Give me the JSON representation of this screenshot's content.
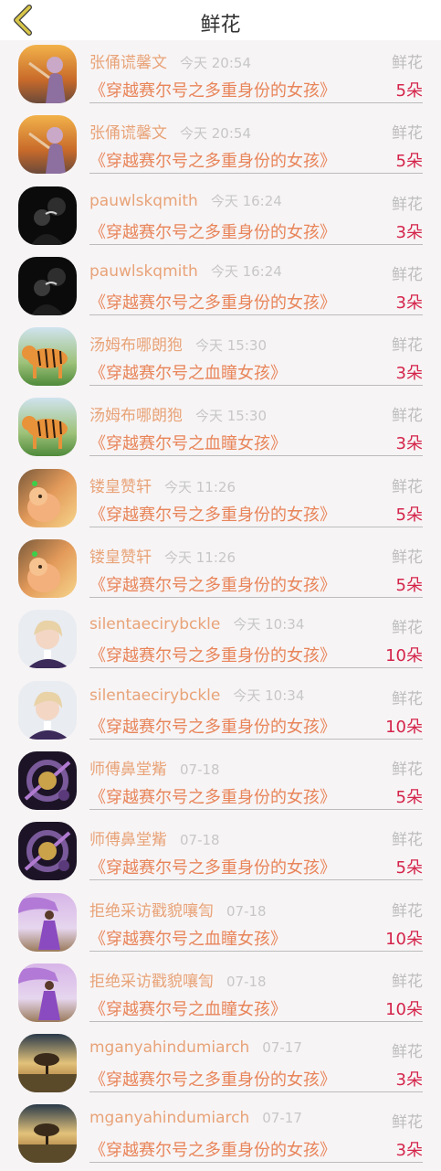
{
  "header": {
    "title": "鲜花",
    "back_icon": "chevron-left-icon",
    "back_color": "#d8c64a"
  },
  "rows": [
    {
      "name": "张俑谎馨文",
      "time": "今天 20:54",
      "type": "鲜花",
      "book": "《穿越赛尔号之多重身份的女孩》",
      "count": "5朵",
      "avatar": "girl-autumn"
    },
    {
      "name": "张俑谎馨文",
      "time": "今天 20:54",
      "type": "鲜花",
      "book": "《穿越赛尔号之多重身份的女孩》",
      "count": "5朵",
      "avatar": "girl-autumn"
    },
    {
      "name": "pauwlskqmith",
      "time": "今天 16:24",
      "type": "鲜花",
      "book": "《穿越赛尔号之多重身份的女孩》",
      "count": "3朵",
      "avatar": "dark-couple"
    },
    {
      "name": "pauwlskqmith",
      "time": "今天 16:24",
      "type": "鲜花",
      "book": "《穿越赛尔号之多重身份的女孩》",
      "count": "3朵",
      "avatar": "dark-couple"
    },
    {
      "name": "汤姆布哪朗狍",
      "time": "今天 15:30",
      "type": "鲜花",
      "book": "《穿越赛尔号之血瞳女孩》",
      "count": "3朵",
      "avatar": "tiger"
    },
    {
      "name": "汤姆布哪朗狍",
      "time": "今天 15:30",
      "type": "鲜花",
      "book": "《穿越赛尔号之血瞳女孩》",
      "count": "3朵",
      "avatar": "tiger"
    },
    {
      "name": "镂皇赞轩",
      "time": "今天 11:26",
      "type": "鲜花",
      "book": "《穿越赛尔号之多重身份的女孩》",
      "count": "5朵",
      "avatar": "pig"
    },
    {
      "name": "镂皇赞轩",
      "time": "今天 11:26",
      "type": "鲜花",
      "book": "《穿越赛尔号之多重身份的女孩》",
      "count": "5朵",
      "avatar": "pig"
    },
    {
      "name": "silentaecirybckle",
      "time": "今天 10:34",
      "type": "鲜花",
      "book": "《穿越赛尔号之多重身份的女孩》",
      "count": "10朵",
      "avatar": "blond-boy"
    },
    {
      "name": "silentaecirybckle",
      "time": "今天 10:34",
      "type": "鲜花",
      "book": "《穿越赛尔号之多重身份的女孩》",
      "count": "10朵",
      "avatar": "blond-boy"
    },
    {
      "name": "师傅鼻堂觜",
      "time": "07-18",
      "type": "鲜花",
      "book": "《穿越赛尔号之多重身份的女孩》",
      "count": "5朵",
      "avatar": "purple-gear"
    },
    {
      "name": "师傅鼻堂觜",
      "time": "07-18",
      "type": "鲜花",
      "book": "《穿越赛尔号之多重身份的女孩》",
      "count": "5朵",
      "avatar": "purple-gear"
    },
    {
      "name": "拒绝采访戳貌嚷訇",
      "time": "07-18",
      "type": "鲜花",
      "book": "《穿越赛尔号之血瞳女孩》",
      "count": "10朵",
      "avatar": "purple-dress"
    },
    {
      "name": "拒绝采访戳貌嚷訇",
      "time": "07-18",
      "type": "鲜花",
      "book": "《穿越赛尔号之血瞳女孩》",
      "count": "10朵",
      "avatar": "purple-dress"
    },
    {
      "name": "mganyahindumiarch",
      "time": "07-17",
      "type": "鲜花",
      "book": "《穿越赛尔号之多重身份的女孩》",
      "count": "3朵",
      "avatar": "sunset-tree"
    },
    {
      "name": "mganyahindumiarch",
      "time": "07-17",
      "type": "鲜花",
      "book": "《穿越赛尔号之多重身份的女孩》",
      "count": "3朵",
      "avatar": "sunset-tree"
    }
  ]
}
